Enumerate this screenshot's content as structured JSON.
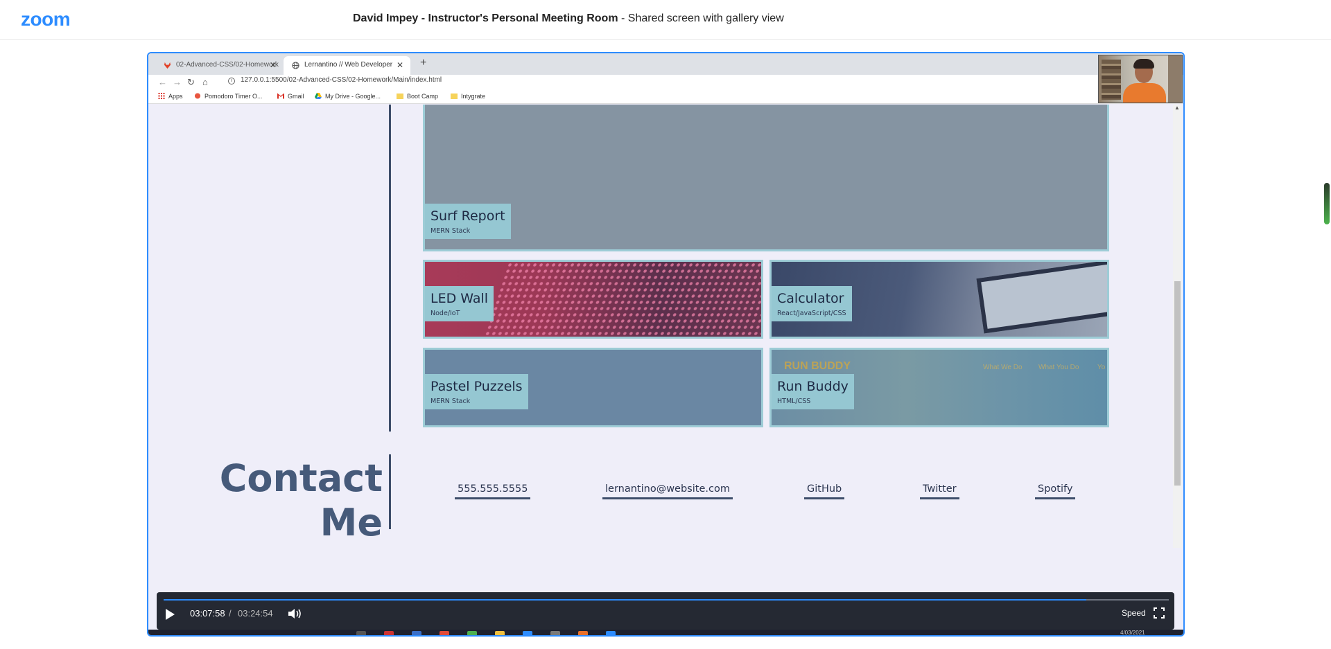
{
  "zoom": {
    "logo": "zoom",
    "meeting_title_bold": "David Impey - Instructor's Personal Meeting Room",
    "meeting_title_rest": " - Shared screen with gallery view"
  },
  "browser": {
    "tabs": [
      {
        "label": "02-Advanced-CSS/02-Homework"
      },
      {
        "label": "Lernantino // Web Developer"
      }
    ],
    "new_tab": "+",
    "url": "127.0.0.1:5500/02-Advanced-CSS/02-Homework/Main/index.html",
    "bookmarks": [
      {
        "label": "Apps"
      },
      {
        "label": "Pomodoro Timer O..."
      },
      {
        "label": "Gmail"
      },
      {
        "label": "My Drive - Google..."
      },
      {
        "label": "Boot Camp"
      },
      {
        "label": "Intygrate"
      }
    ]
  },
  "portfolio": {
    "projects": [
      {
        "title": "Surf Report",
        "subtitle": "MERN Stack"
      },
      {
        "title": "LED Wall",
        "subtitle": "Node/IoT"
      },
      {
        "title": "Calculator",
        "subtitle": "React/JavaScript/CSS"
      },
      {
        "title": "Pastel Puzzels",
        "subtitle": "MERN Stack"
      },
      {
        "title": "Run Buddy",
        "subtitle": "HTML/CSS"
      }
    ],
    "run_buddy_ghost": {
      "title": "RUN BUDDY",
      "nav": [
        "What We Do",
        "What You Do",
        "Yo"
      ]
    },
    "contact": {
      "heading_line1": "Contact",
      "heading_line2": "Me",
      "links": [
        "555.555.5555",
        "lernantino@website.com",
        "GitHub",
        "Twitter",
        "Spotify"
      ]
    }
  },
  "player": {
    "current_time": "03:07:58",
    "separator": "/",
    "total_time": "03:24:54",
    "speed_label": "Speed",
    "progress": 0.918
  },
  "taskbar": {
    "date": "4/03/2021"
  },
  "colors": {
    "zoom_blue": "#2d8cff",
    "card_border": "#9dccd6",
    "label_bg": "#95c7d2",
    "heading": "#465a7a"
  }
}
